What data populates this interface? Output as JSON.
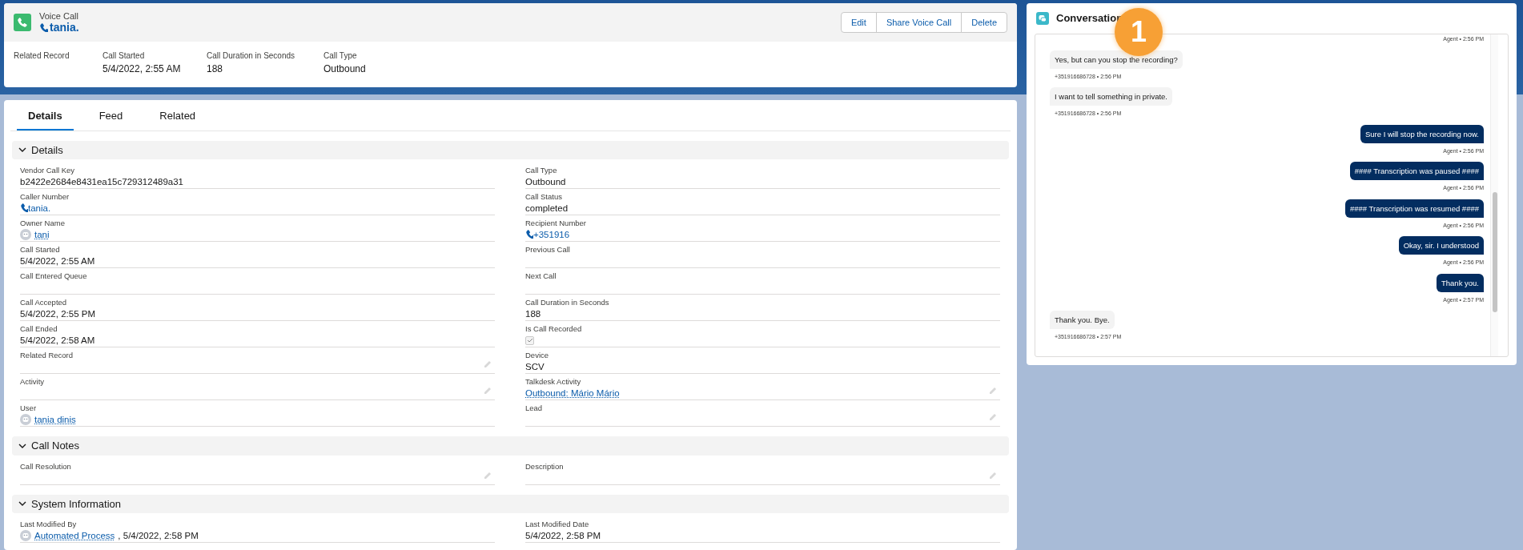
{
  "header": {
    "object_type": "Voice Call",
    "title": "tania.",
    "buttons": [
      "Edit",
      "Share Voice Call",
      "Delete"
    ],
    "highlights": [
      {
        "label": "Related Record"
      },
      {
        "label": "Call Started",
        "value": "5/4/2022, 2:55 AM"
      },
      {
        "label": "Call Duration in Seconds",
        "value": "188"
      },
      {
        "label": "Call Type",
        "value": "Outbound"
      }
    ]
  },
  "tabs": [
    {
      "label": "Details",
      "selected": true
    },
    {
      "label": "Feed",
      "selected": false
    },
    {
      "label": "Related",
      "selected": false
    }
  ],
  "sections": [
    {
      "title": "Details",
      "expanded": true,
      "fields": [
        {
          "label": "Vendor Call Key",
          "value": "b2422e2684e8431ea15c729312489a31",
          "kind": "text",
          "editable": false
        },
        {
          "label": "Call Type",
          "value": "Outbound",
          "kind": "text",
          "editable": false
        },
        {
          "label": "Caller Number",
          "value": "tania.",
          "kind": "phone",
          "editable": false
        },
        {
          "label": "Call Status",
          "value": "completed",
          "kind": "text",
          "editable": false
        },
        {
          "label": "Owner Name",
          "value": "tani",
          "kind": "user",
          "editable": false
        },
        {
          "label": "Recipient Number",
          "value": "+351916",
          "kind": "phone",
          "editable": false
        },
        {
          "label": "Call Started",
          "value": "5/4/2022, 2:55 AM",
          "kind": "text",
          "editable": false
        },
        {
          "label": "Previous Call",
          "kind": "text",
          "editable": false
        },
        {
          "label": "Call Entered Queue",
          "kind": "text",
          "editable": false
        },
        {
          "label": "Next Call",
          "kind": "text",
          "editable": false
        },
        {
          "label": "Call Accepted",
          "value": "5/4/2022, 2:55 PM",
          "kind": "text",
          "editable": false
        },
        {
          "label": "Call Duration in Seconds",
          "value": "188",
          "kind": "text",
          "editable": false
        },
        {
          "label": "Call Ended",
          "value": "5/4/2022, 2:58 AM",
          "kind": "text",
          "editable": false
        },
        {
          "label": "Is Call Recorded",
          "kind": "checkbox",
          "checked": true,
          "editable": false
        },
        {
          "label": "Related Record",
          "kind": "text",
          "editable": true
        },
        {
          "label": "Device",
          "value": "SCV",
          "kind": "text",
          "editable": false
        },
        {
          "label": "Activity",
          "kind": "text",
          "editable": true
        },
        {
          "label": "Talkdesk Activity",
          "value": "Outbound: Mário Mário",
          "kind": "link",
          "editable": true
        },
        {
          "label": "User",
          "value": "tania dinis",
          "kind": "user",
          "editable": false
        },
        {
          "label": "Lead",
          "kind": "text",
          "editable": true
        }
      ]
    },
    {
      "title": "Call Notes",
      "expanded": true,
      "fields": [
        {
          "label": "Call Resolution",
          "kind": "text",
          "editable": true
        },
        {
          "label": "Description",
          "kind": "text",
          "editable": true
        }
      ]
    },
    {
      "title": "System Information",
      "expanded": true,
      "fields": [
        {
          "label": "Last Modified By",
          "value": "Automated Process",
          "suffix": ", 5/4/2022, 2:58 PM",
          "kind": "user",
          "editable": false
        },
        {
          "label": "Last Modified Date",
          "value": "5/4/2022, 2:58 PM",
          "kind": "text",
          "editable": false
        }
      ]
    }
  ],
  "conversation": {
    "title": "Conversation",
    "callout": "1",
    "messages": [
      {
        "kind": "agent",
        "meta": "Agent • 2:56 PM"
      },
      {
        "kind": "customer",
        "text": "Yes, but can you stop the recording?",
        "meta": "+351916686728 • 2:56 PM"
      },
      {
        "kind": "customer",
        "text": "I want to tell something in private.",
        "meta": "+351916686728 • 2:56 PM"
      },
      {
        "kind": "agent",
        "text": "Sure I will stop the recording now.",
        "meta": "Agent • 2:56 PM"
      },
      {
        "kind": "agent",
        "text": "#### Transcription was paused ####",
        "meta": "Agent • 2:56 PM"
      },
      {
        "kind": "agent",
        "text": "#### Transcription was resumed ####",
        "meta": "Agent • 2:56 PM"
      },
      {
        "kind": "agent",
        "text": "Okay, sir. I understood",
        "meta": "Agent • 2:56 PM"
      },
      {
        "kind": "agent",
        "text": "Thank you.",
        "meta": "Agent • 2:57 PM"
      },
      {
        "kind": "customer",
        "text": "Thank you. Bye.",
        "meta": "+351916686728 • 2:57 PM"
      }
    ]
  }
}
